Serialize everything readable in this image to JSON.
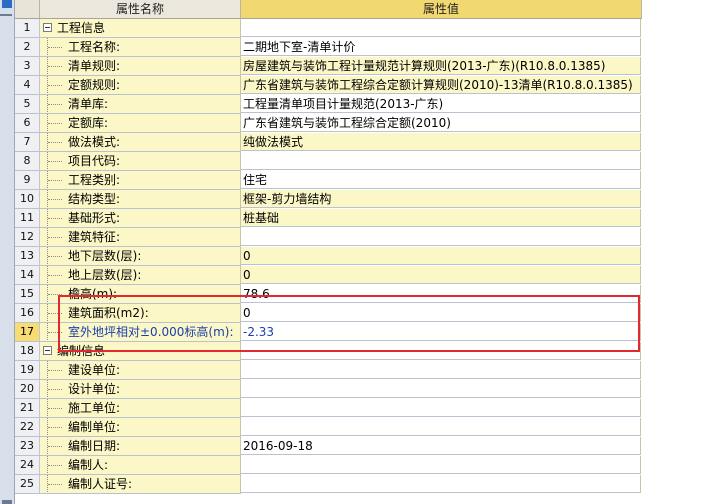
{
  "header": {
    "col_number": "",
    "col_name": "属性名称",
    "col_value": "属性值"
  },
  "rows": [
    {
      "num": "1",
      "name": "工程信息",
      "value": "",
      "type": "group"
    },
    {
      "num": "2",
      "name": "工程名称:",
      "value": "二期地下室-清单计价"
    },
    {
      "num": "3",
      "name": "清单规则:",
      "value": "房屋建筑与装饰工程计量规范计算规则(2013-广东)(R10.8.0.1385)"
    },
    {
      "num": "4",
      "name": "定额规则:",
      "value": "广东省建筑与装饰工程综合定额计算规则(2010)-13清单(R10.8.0.1385)"
    },
    {
      "num": "5",
      "name": "清单库:",
      "value": "工程量清单项目计量规范(2013-广东)"
    },
    {
      "num": "6",
      "name": "定额库:",
      "value": "广东省建筑与装饰工程综合定额(2010)"
    },
    {
      "num": "7",
      "name": "做法模式:",
      "value": "纯做法模式"
    },
    {
      "num": "8",
      "name": "项目代码:",
      "value": ""
    },
    {
      "num": "9",
      "name": "工程类别:",
      "value": "住宅"
    },
    {
      "num": "10",
      "name": "结构类型:",
      "value": "框架-剪力墙结构"
    },
    {
      "num": "11",
      "name": "基础形式:",
      "value": "桩基础"
    },
    {
      "num": "12",
      "name": "建筑特征:",
      "value": ""
    },
    {
      "num": "13",
      "name": "地下层数(层):",
      "value": "0"
    },
    {
      "num": "14",
      "name": "地上层数(层):",
      "value": "0"
    },
    {
      "num": "15",
      "name": "檐高(m):",
      "value": "78.6"
    },
    {
      "num": "16",
      "name": "建筑面积(m2):",
      "value": "0"
    },
    {
      "num": "17",
      "name": "室外地坪相对±0.000标高(m):",
      "value": "-2.33",
      "selected": true
    },
    {
      "num": "18",
      "name": "编制信息",
      "value": "",
      "type": "group"
    },
    {
      "num": "19",
      "name": "建设单位:",
      "value": ""
    },
    {
      "num": "20",
      "name": "设计单位:",
      "value": ""
    },
    {
      "num": "21",
      "name": "施工单位:",
      "value": ""
    },
    {
      "num": "22",
      "name": "编制单位:",
      "value": ""
    },
    {
      "num": "23",
      "name": "编制日期:",
      "value": "2016-09-18"
    },
    {
      "num": "24",
      "name": "编制人:",
      "value": ""
    },
    {
      "num": "25",
      "name": "编制人证号:",
      "value": ""
    }
  ]
}
